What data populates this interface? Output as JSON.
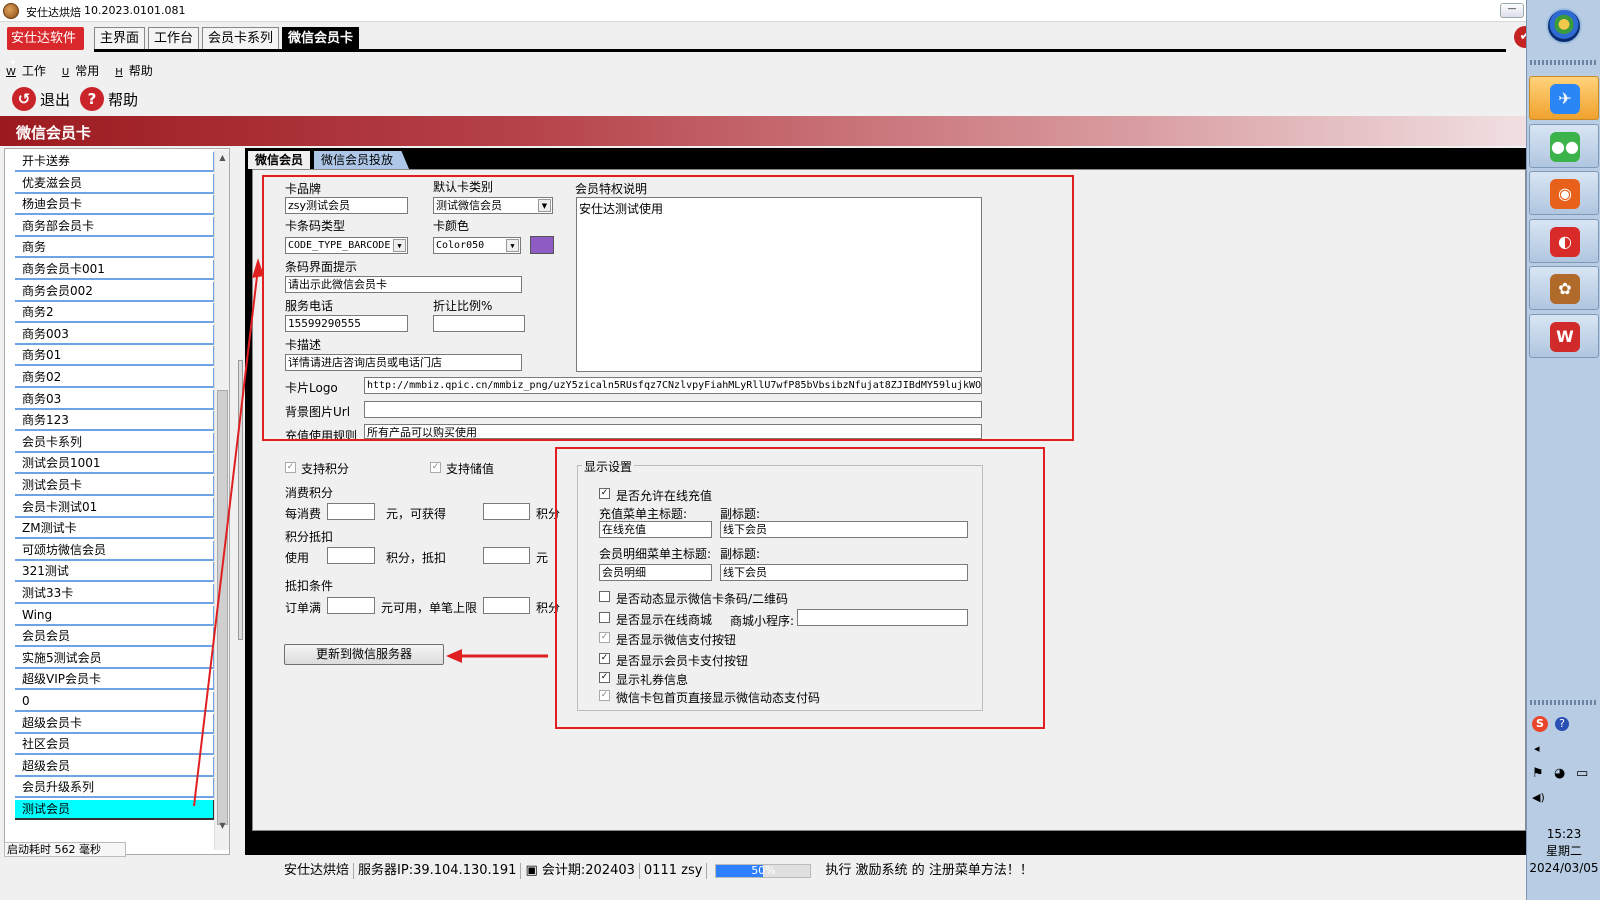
{
  "window": {
    "title": "安仕达烘焙",
    "version": "10.2023.0101.081",
    "minimize_glyph": "—",
    "close_glyph": "✔"
  },
  "brand": {
    "label": "安仕达软件",
    "caret": "▾"
  },
  "main_tabs": [
    "主界面",
    "工作台",
    "会员卡系列",
    "微信会员卡"
  ],
  "menu": [
    {
      "hotkey": "W",
      "label": "工作"
    },
    {
      "hotkey": "U",
      "label": "常用"
    },
    {
      "hotkey": "H",
      "label": "帮助"
    }
  ],
  "toolbar": {
    "exit_label": "退出",
    "exit_icon": "↺",
    "help_label": "帮助",
    "help_icon": "?"
  },
  "header": {
    "title": "微信会员卡"
  },
  "card_list": {
    "items": [
      "开卡送券",
      "优麦滋会员",
      "杨迪会员卡",
      "商务部会员卡",
      "商务",
      "商务会员卡001",
      "商务会员002",
      "商务2",
      "商务003",
      "商务01",
      "商务02",
      "商务03",
      "商务123",
      "会员卡系列",
      "测试会员1001",
      "测试会员卡",
      "会员卡测试01",
      "ZM测试卡",
      "可颂坊微信会员",
      "321测试",
      "测试33卡",
      "Wing",
      "会员会员",
      "实施5测试会员",
      "超级VIP会员卡",
      "0",
      "超级会员卡",
      "社区会员",
      "超级会员",
      "会员升级系列",
      "测试会员"
    ],
    "selected": "测试会员",
    "scroll_up": "▲",
    "scroll_down": "▼"
  },
  "sub_tabs": [
    "微信会员",
    "微信会员投放"
  ],
  "form": {
    "brand_label": "卡品牌",
    "brand_value": "zsy测试会员",
    "default_type_label": "默认卡类别",
    "default_type_value": "测试微信会员",
    "privilege_label": "会员特权说明",
    "privilege_value": "安仕达测试使用",
    "barcode_type_label": "卡条码类型",
    "barcode_type_value": "CODE_TYPE_BARCODE",
    "color_label": "卡颜色",
    "color_value": "Color050",
    "color_hex": "#8e5cc4",
    "barcode_tip_label": "条码界面提示",
    "barcode_tip_value": "请出示此微信会员卡",
    "phone_label": "服务电话",
    "phone_value": "15599290555",
    "discount_label": "折让比例%",
    "discount_value": "",
    "desc_label": "卡描述",
    "desc_value": "详情请进店咨询店员或电话门店",
    "logo_label": "卡片Logo",
    "logo_value": "http://mmbiz.qpic.cn/mmbiz_png/uzY5zicaln5RUsfqz7CNzlvpyFiahMLyRllU7wfP85bVbsibzNfujat8ZJIBdMY59lujkWOH1S",
    "bg_label": "背景图片Url",
    "bg_value": "",
    "recharge_rule_label": "充值使用规则",
    "recharge_rule_value": "所有产品可以购买使用"
  },
  "points": {
    "support_points": "支持积分",
    "support_stored": "支持储值",
    "consume_points_label": "消费积分",
    "per_spend": "每消费",
    "yuan_get": "元，可获得",
    "points_unit": "积分",
    "deduct_label": "积分抵扣",
    "use": "使用",
    "points_deduct": "积分，抵扣",
    "yuan": "元",
    "condition_label": "抵扣条件",
    "order_full": "订单满",
    "yuan_usable": "元可用，单笔上限",
    "update_button": "更新到微信服务器"
  },
  "display": {
    "legend": "显示设置",
    "allow_recharge": "是否允许在线充值",
    "recharge_main_title_label": "充值菜单主标题:",
    "recharge_sub_title_label": "副标题:",
    "recharge_main_title": "在线充值",
    "recharge_sub_title": "线下会员",
    "detail_main_title_label": "会员明细菜单主标题:",
    "detail_sub_title_label": "副标题:",
    "detail_main_title": "会员明细",
    "detail_sub_title": "线下会员",
    "dynamic_code": "是否动态显示微信卡条码/二维码",
    "online_mall": "是否显示在线商城",
    "mall_miniprogram_label": "商城小程序:",
    "mall_miniprogram_value": "",
    "wechat_pay": "是否显示微信支付按钮",
    "card_pay": "是否显示会员卡支付按钮",
    "coupon_info": "显示礼券信息",
    "home_dynamic_pay": "微信卡包首页直接显示微信动态支付码",
    "check_glyph": "✓"
  },
  "status": {
    "startup": "启动耗时 562 毫秒",
    "company": "安仕达烘焙",
    "server": "服务器IP:39.104.130.191",
    "period": "会计期:202403",
    "user": "0111 zsy",
    "progress_percent": 50,
    "progress_text": "50%",
    "message": "执行 激励系统 的 注册菜单方法！！"
  },
  "taskbar": {
    "time": "15:23",
    "weekday": "星期二",
    "date": "2024/03/05",
    "app_icons": [
      {
        "name": "feishu",
        "glyph": "✈",
        "color": "#2b86f5"
      },
      {
        "name": "wechat",
        "glyph": "●●",
        "color": "#3cb34a"
      },
      {
        "name": "firefox",
        "glyph": "◉",
        "color": "#e8611a"
      },
      {
        "name": "browser",
        "glyph": "◐",
        "color": "#d92a2a"
      },
      {
        "name": "bakery",
        "glyph": "✿",
        "color": "#b06a2a"
      },
      {
        "name": "wps",
        "glyph": "W",
        "color": "#d12a2a"
      }
    ],
    "tray": {
      "ime_glyph": "S",
      "help_glyph": "?",
      "expand_glyph": "◂",
      "flag_glyph": "⚑",
      "qq_glyph": "◕",
      "network_glyph": "▭",
      "volume_glyph": "◀)"
    }
  }
}
